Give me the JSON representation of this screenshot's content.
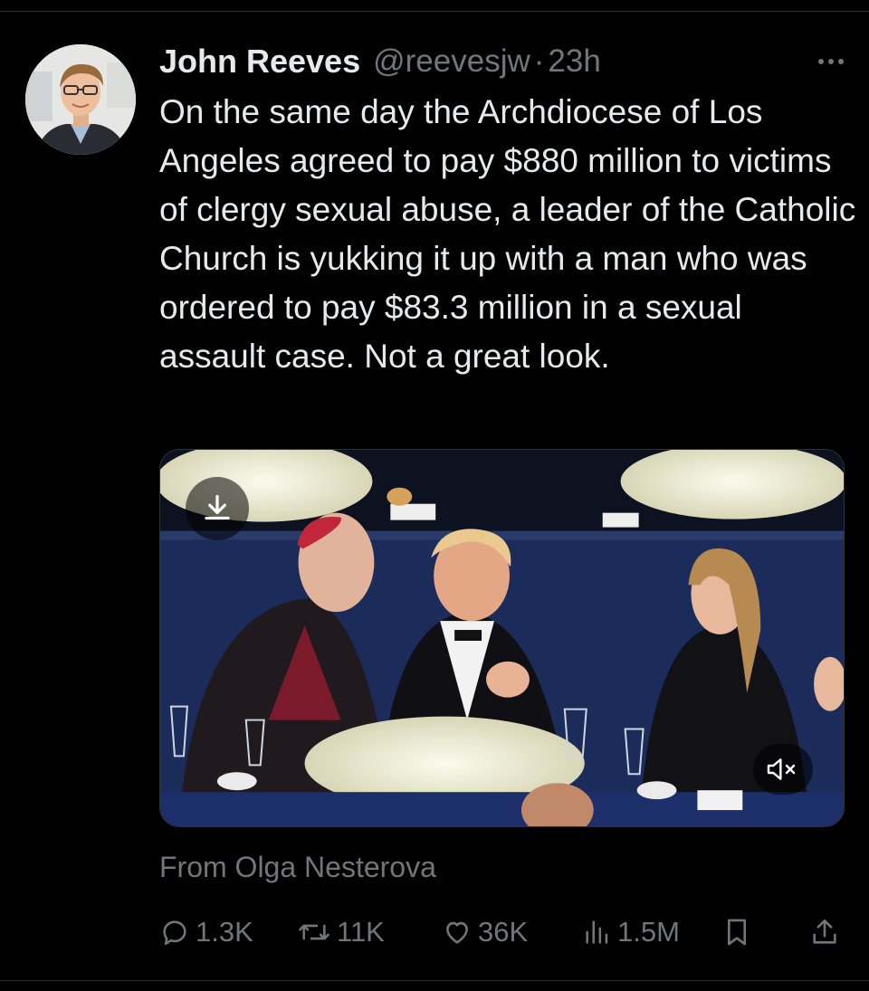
{
  "tweet": {
    "author_name": "John Reeves",
    "handle": "@reevesjw",
    "separator": "·",
    "time": "23h",
    "text": "On the same day the Archdiocese of Los Angeles agreed to pay $880 million to victims of clergy sexual abuse, a leader of the Catholic Church is yukking it up with a man who was ordered to pay $83.3 million in a sexual assault case. Not a great look.",
    "attribution": "From Olga Nesterova"
  },
  "icons": {
    "more": "more-dots-icon",
    "download": "download-icon",
    "mute": "mute-icon",
    "reply": "reply-icon",
    "retweet": "retweet-icon",
    "like": "heart-icon",
    "views": "views-icon",
    "bookmark": "bookmark-icon",
    "share": "share-icon"
  },
  "stats": {
    "replies": "1.3K",
    "retweets": "11K",
    "likes": "36K",
    "views": "1.5M"
  },
  "colors": {
    "background": "#000000",
    "text": "#e7e9ea",
    "secondary": "#71767b",
    "divider": "#2f3336"
  }
}
